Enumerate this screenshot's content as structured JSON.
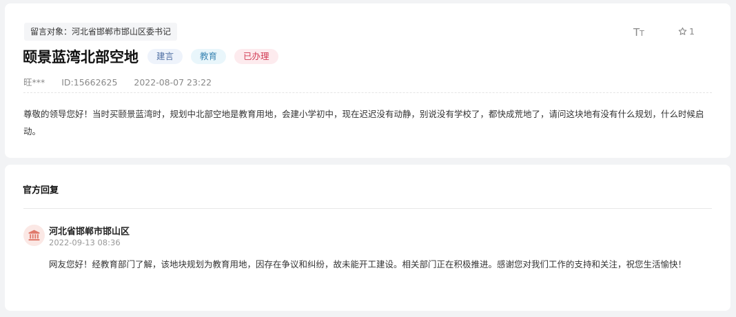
{
  "message": {
    "target_label": "留言对象：河北省邯郸市邯山区委书记",
    "title": "颐景蓝湾北部空地",
    "badges": [
      "建言",
      "教育",
      "已办理"
    ],
    "author": "旺***",
    "id": "ID:15662625",
    "datetime": "2022-08-07 23:22",
    "content": "尊敬的领导您好！当时买颐景蓝湾时，规划中北部空地是教育用地，会建小学初中，现在迟迟没有动静，别说没有学校了，都快成荒地了，请问这块地有没有什么规划，什么时候启动。",
    "font_size_icon": "font-size-icon",
    "favorite_count": "1"
  },
  "reply": {
    "heading": "官方回复",
    "replier": "河北省邯郸市邯山区",
    "time": "2022-09-13 08:36",
    "text": "网友您好！经教育部门了解，该地块规划为教育用地，因存在争议和纠纷，故未能开工建设。相关部门正在积极推进。感谢您对我们工作的支持和关注，祝您生活愉快！",
    "avatar_icon": "government-building-icon"
  },
  "colors": {
    "page_bg": "#f2f3f5",
    "badge_blue": "#4f6fa3",
    "badge_cyan": "#3b86b3",
    "badge_red": "#d23c54",
    "avatar_bg": "#fbe8e5",
    "avatar_icon": "#e07a6c"
  }
}
